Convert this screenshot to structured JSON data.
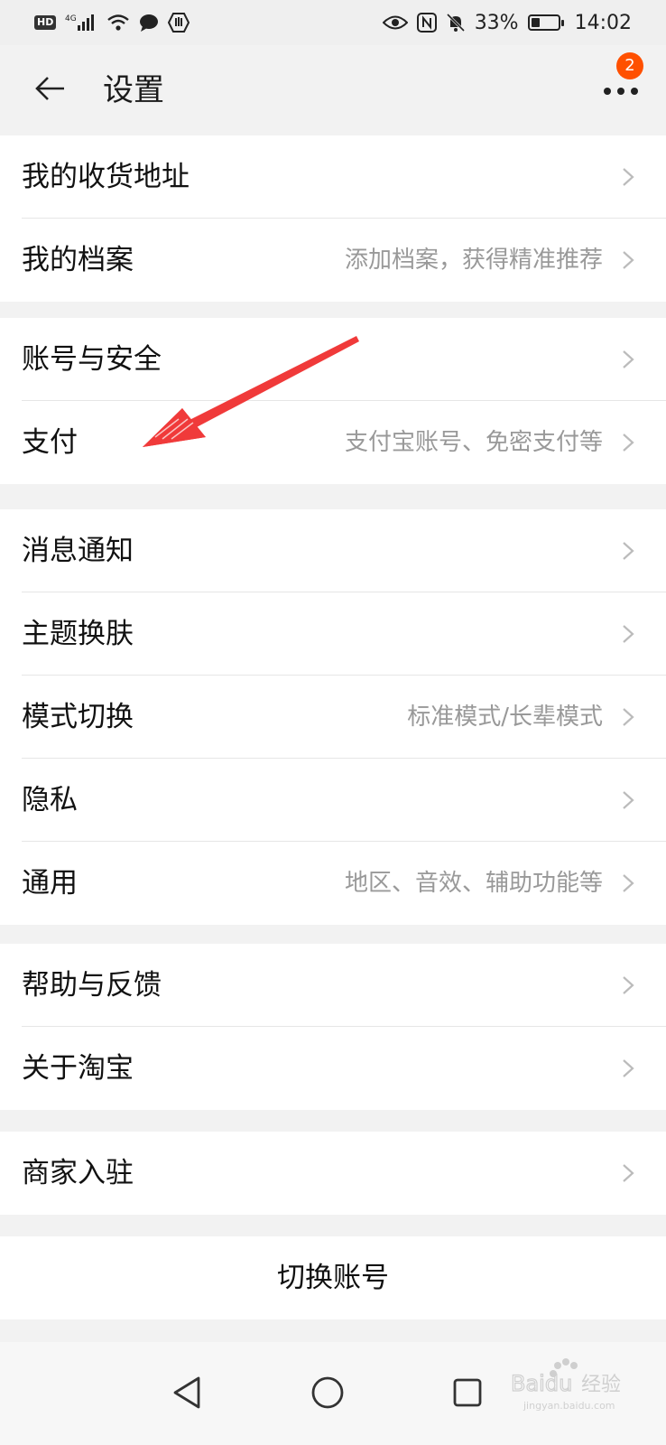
{
  "status_bar": {
    "hd": "HD",
    "network": "4G",
    "battery_percent": "33%",
    "battery_level": 0.33,
    "time": "14:02"
  },
  "header": {
    "title": "设置",
    "badge_count": "2"
  },
  "groups": [
    {
      "items": [
        {
          "label": "我的收货地址",
          "hint": ""
        },
        {
          "label": "我的档案",
          "hint": "添加档案，获得精准推荐"
        }
      ]
    },
    {
      "items": [
        {
          "label": "账号与安全",
          "hint": ""
        },
        {
          "label": "支付",
          "hint": "支付宝账号、免密支付等"
        }
      ]
    },
    {
      "items": [
        {
          "label": "消息通知",
          "hint": ""
        },
        {
          "label": "主题换肤",
          "hint": ""
        },
        {
          "label": "模式切换",
          "hint": "标准模式/长辈模式"
        },
        {
          "label": "隐私",
          "hint": ""
        },
        {
          "label": "通用",
          "hint": "地区、音效、辅助功能等"
        }
      ]
    },
    {
      "items": [
        {
          "label": "帮助与反馈",
          "hint": ""
        },
        {
          "label": "关于淘宝",
          "hint": ""
        }
      ]
    },
    {
      "items": [
        {
          "label": "商家入驻",
          "hint": ""
        }
      ]
    }
  ],
  "switch_account": {
    "label": "切换账号"
  },
  "watermark": {
    "brand": "Baidu",
    "suffix": "经验",
    "url": "jingyan.baidu.com"
  },
  "colors": {
    "accent": "#ff5000",
    "annotation_arrow": "#f03a3a"
  }
}
